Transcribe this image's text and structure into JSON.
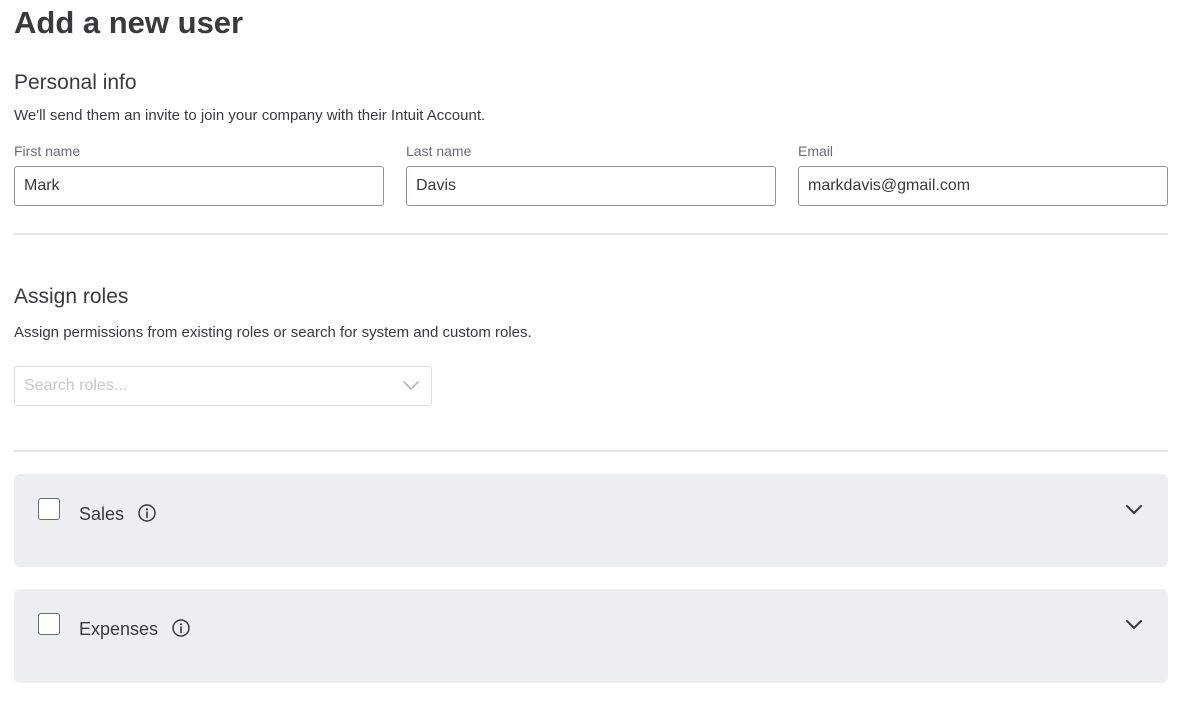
{
  "page": {
    "title": "Add a new user"
  },
  "personal_info": {
    "title": "Personal info",
    "description": "We'll send them an invite to join your company with their Intuit Account.",
    "fields": [
      {
        "label": "First name",
        "value": "Mark"
      },
      {
        "label": "Last name",
        "value": "Davis"
      },
      {
        "label": "Email",
        "value": "markdavis@gmail.com"
      }
    ]
  },
  "assign_roles": {
    "title": "Assign roles",
    "description": "Assign permissions from existing roles or search for system and custom roles.",
    "search": {
      "placeholder": "Search roles..."
    },
    "roles": [
      {
        "name": "Sales",
        "checked": false,
        "expanded": false
      },
      {
        "name": "Expenses",
        "checked": false,
        "expanded": false
      }
    ]
  },
  "icons": {
    "chevron": "chevron-down-icon",
    "info": "info-icon"
  },
  "colors": {
    "text": "#393a3d",
    "label": "#6b6c72",
    "card_background": "#eceef1",
    "divider": "#e3e5e8",
    "input_border": "#8d9096"
  }
}
